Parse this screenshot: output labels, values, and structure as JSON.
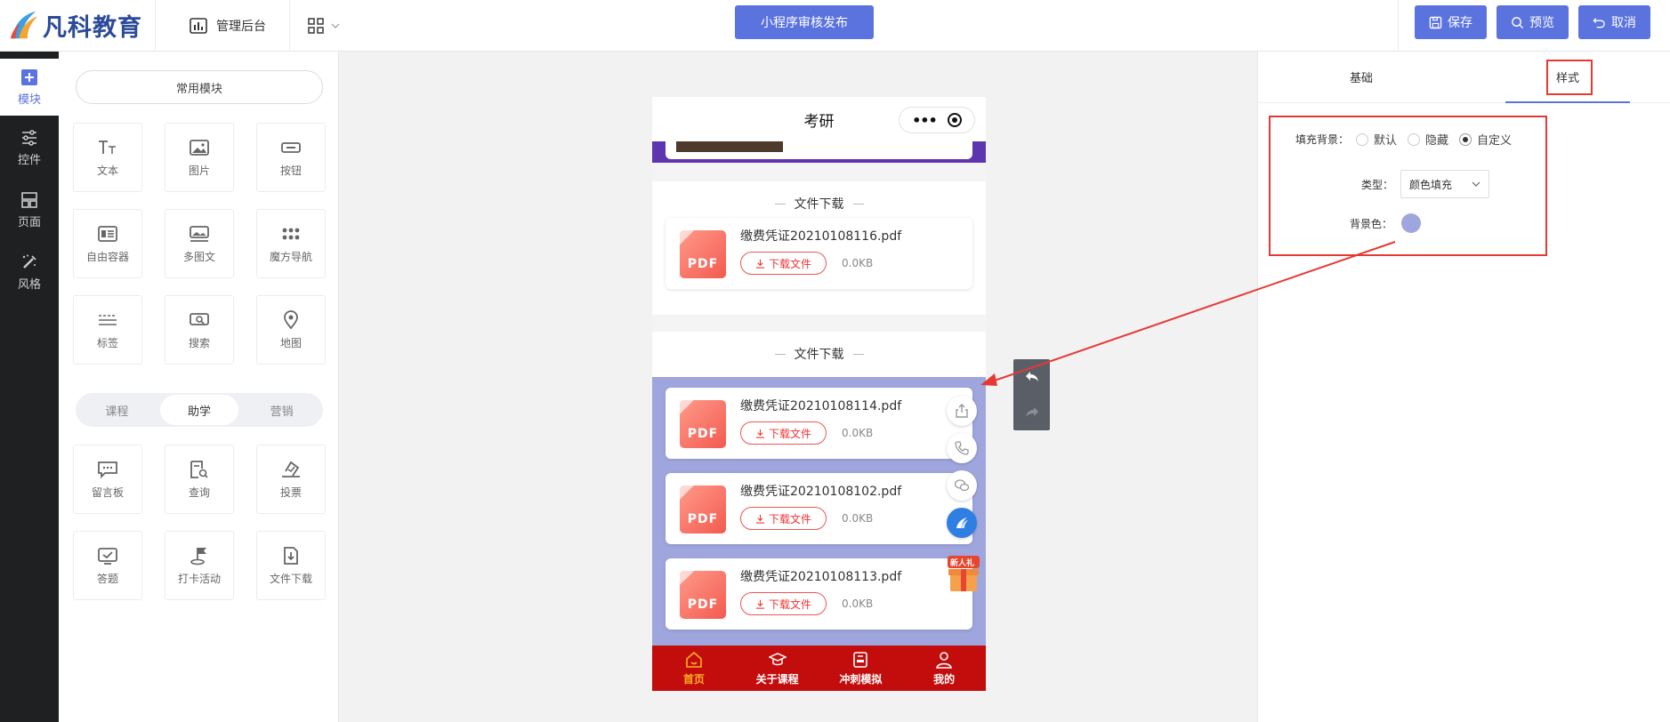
{
  "colors": {
    "primary": "#5b73df",
    "rail_bg": "#1f2022",
    "tabbar_red": "#c30d0d",
    "tab_active": "#ffb020",
    "custom_bg": "#9fa6de",
    "annotation_red": "#e53935",
    "purple_banner": "#5e35b1"
  },
  "header": {
    "brand": "凡科教育",
    "admin_label": "管理后台",
    "grid_menu_icon": "grid-icon",
    "publish_label": "小程序审核发布",
    "save_label": "保存",
    "preview_label": "预览",
    "cancel_label": "取消"
  },
  "rail": {
    "items": [
      {
        "label": "模块",
        "icon": "plus-square-icon"
      },
      {
        "label": "控件",
        "icon": "sliders-icon"
      },
      {
        "label": "页面",
        "icon": "layout-icon"
      },
      {
        "label": "风格",
        "icon": "brush-icon"
      }
    ]
  },
  "modules": {
    "common_label": "常用模块",
    "common": [
      {
        "label": "文本",
        "icon": "text-icon"
      },
      {
        "label": "图片",
        "icon": "image-icon"
      },
      {
        "label": "按钮",
        "icon": "button-icon"
      },
      {
        "label": "自由容器",
        "icon": "container-icon"
      },
      {
        "label": "多图文",
        "icon": "multi-image-text-icon"
      },
      {
        "label": "魔方导航",
        "icon": "dots-grid-icon"
      },
      {
        "label": "标签",
        "icon": "tag-icon"
      },
      {
        "label": "搜索",
        "icon": "search-icon"
      },
      {
        "label": "地图",
        "icon": "map-pin-icon"
      }
    ],
    "segments": [
      "课程",
      "助学",
      "营销"
    ],
    "active_segment": "助学",
    "assist": [
      {
        "label": "留言板",
        "icon": "message-board-icon"
      },
      {
        "label": "查询",
        "icon": "query-icon"
      },
      {
        "label": "投票",
        "icon": "vote-icon"
      },
      {
        "label": "答题",
        "icon": "quiz-icon"
      },
      {
        "label": "打卡活动",
        "icon": "checkin-icon"
      },
      {
        "label": "文件下载",
        "icon": "file-download-icon"
      }
    ]
  },
  "phone": {
    "title": "考研",
    "sections": [
      {
        "title": "文件下载",
        "files": [
          {
            "name": "缴费凭证20210108116.pdf",
            "button": "下载文件",
            "size": "0.0KB",
            "badge": "PDF"
          }
        ]
      },
      {
        "title": "文件下载",
        "files": [
          {
            "name": "缴费凭证20210108114.pdf",
            "button": "下载文件",
            "size": "0.0KB",
            "badge": "PDF"
          },
          {
            "name": "缴费凭证20210108102.pdf",
            "button": "下载文件",
            "size": "0.0KB",
            "badge": "PDF"
          },
          {
            "name": "缴费凭证20210108113.pdf",
            "button": "下载文件",
            "size": "0.0KB",
            "badge": "PDF"
          }
        ]
      }
    ],
    "gift_label": "新人礼",
    "tabs": [
      {
        "label": "首页",
        "icon": "home-icon",
        "active": true
      },
      {
        "label": "关于课程",
        "icon": "graduation-cap-icon",
        "active": false
      },
      {
        "label": "冲刺模拟",
        "icon": "exam-icon",
        "active": false
      },
      {
        "label": "我的",
        "icon": "user-icon",
        "active": false
      }
    ]
  },
  "style_panel": {
    "tabs": [
      "基础",
      "样式"
    ],
    "active_tab": "样式",
    "fill_bg_label": "填充背景：",
    "fill_options": [
      "默认",
      "隐藏",
      "自定义"
    ],
    "fill_selected": "自定义",
    "type_label": "类型：",
    "type_value": "颜色填充",
    "bg_color_label": "背景色：",
    "bg_color_value": "#9fa6de"
  }
}
